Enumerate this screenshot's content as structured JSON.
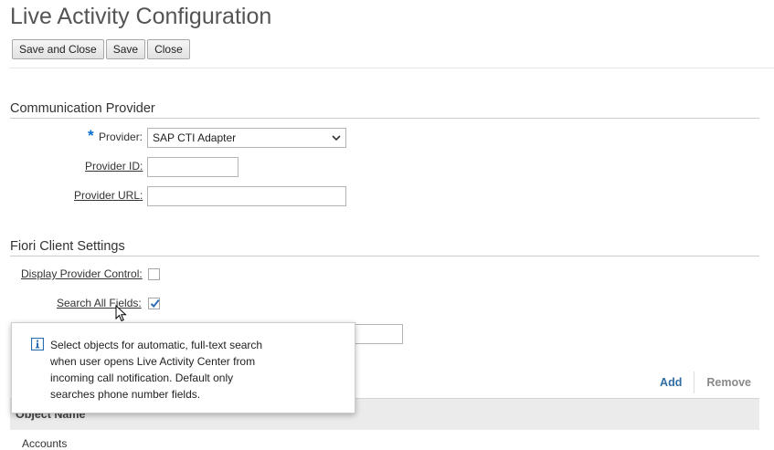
{
  "page_title": "Live Activity Configuration",
  "toolbar": {
    "save_close_label": "Save and Close",
    "save_label": "Save",
    "close_label": "Close"
  },
  "communication_provider": {
    "section_title": "Communication Provider",
    "required_marker": "*",
    "provider_label": "Provider:",
    "provider_value": "SAP CTI Adapter",
    "provider_id_label": "Provider ID:",
    "provider_id_value": "",
    "provider_url_label": "Provider URL:",
    "provider_url_value": ""
  },
  "fiori_client": {
    "section_title": "Fiori Client Settings",
    "display_provider_control_label": "Display Provider Control:",
    "display_provider_control_checked": false,
    "search_all_fields_label": "Search All Fields:",
    "search_all_fields_checked": true
  },
  "table": {
    "add_label": "Add",
    "remove_label": "Remove",
    "column_header": "Object Name",
    "first_row": "Accounts"
  },
  "tooltip": {
    "text": "Select objects for automatic, full-text search when user opens Live Activity Center from incoming call notification. Default only searches phone number fields."
  },
  "colors": {
    "accent": "#0a6ed1",
    "link": "#2e6da4",
    "checkmark": "#2f6fb5"
  },
  "icons": {
    "dropdown": "chevron-down-icon",
    "checkbox_check": "checkmark-icon",
    "tooltip_info": "info-icon",
    "mouse": "mouse-pointer-icon"
  }
}
